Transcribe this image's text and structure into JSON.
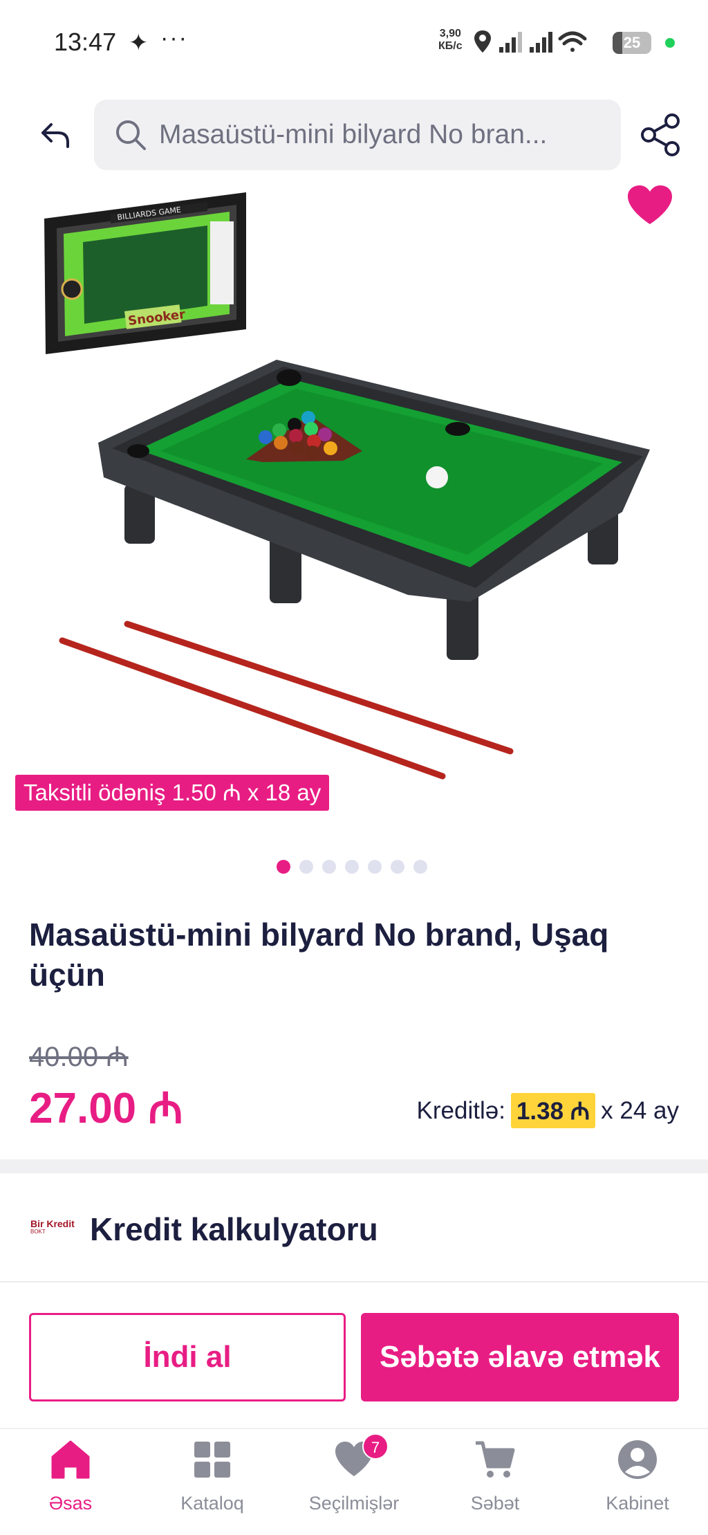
{
  "status_bar": {
    "time": "13:47",
    "speed_value": "3,90",
    "speed_unit": "КБ/с",
    "battery": "25",
    "battery_level_percent": 25
  },
  "header": {
    "search_text": "Masaüstü-mini bilyard No bran...",
    "icons": [
      "back-arrow-icon",
      "search-icon",
      "share-icon",
      "heart-icon"
    ]
  },
  "gallery": {
    "installment_badge": "Taksitli ödəniş 1.50 ₼ x 18 ay",
    "total_images": 7,
    "active_index": 0
  },
  "product": {
    "title": "Masaüstü-mini bilyard No brand, Uşaq üçün",
    "old_price": "40.00 ₼",
    "price": "27.00 ₼",
    "credit_label": "Kreditlə:",
    "credit_amount": "1.38 ₼",
    "credit_term": "x 24 ay"
  },
  "credit_calc": {
    "logo_text": "Bir Kredit",
    "logo_sub": "BOKT",
    "title": "Kredit kalkulyatoru"
  },
  "actions": {
    "buy_now": "İndi al",
    "add_to_cart": "Səbətə əlavə etmək"
  },
  "nav": {
    "items": [
      {
        "label": "Əsas",
        "icon": "home-icon"
      },
      {
        "label": "Kataloq",
        "icon": "grid-icon"
      },
      {
        "label": "Seçilmişlər",
        "icon": "heart-icon",
        "badge": "7"
      },
      {
        "label": "Səbət",
        "icon": "cart-icon"
      },
      {
        "label": "Kabinet",
        "icon": "user-icon"
      }
    ]
  },
  "colors": {
    "accent": "#e81d84",
    "text": "#1c1f3f",
    "muted": "#6f7080",
    "highlight": "#ffd43b"
  }
}
